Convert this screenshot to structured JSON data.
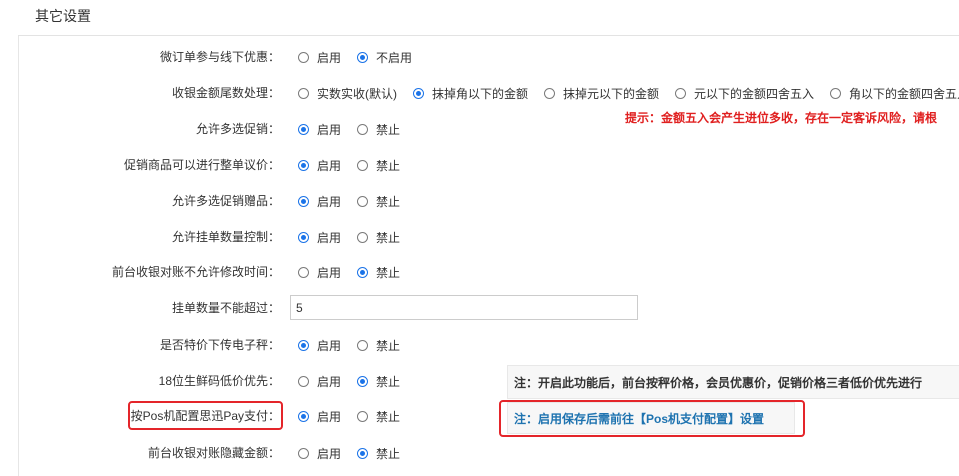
{
  "section": {
    "title": "其它设置"
  },
  "settings": [
    {
      "label": "微订单参与线下优惠：",
      "options": [
        {
          "label": "启用",
          "checked": false
        },
        {
          "label": "不启用",
          "checked": true
        }
      ]
    },
    {
      "label": "收银金额尾数处理：",
      "options": [
        {
          "label": "实数实收(默认)",
          "checked": false
        },
        {
          "label": "抹掉角以下的金额",
          "checked": true
        },
        {
          "label": "抹掉元以下的金额",
          "checked": false
        },
        {
          "label": "元以下的金额四舍五入",
          "checked": false
        },
        {
          "label": "角以下的金额四舍五入",
          "checked": false
        }
      ]
    },
    {
      "label": "允许多选促销：",
      "options": [
        {
          "label": "启用",
          "checked": true
        },
        {
          "label": "禁止",
          "checked": false
        }
      ]
    },
    {
      "label": "促销商品可以进行整单议价：",
      "options": [
        {
          "label": "启用",
          "checked": true
        },
        {
          "label": "禁止",
          "checked": false
        }
      ]
    },
    {
      "label": "允许多选促销赠品：",
      "options": [
        {
          "label": "启用",
          "checked": true
        },
        {
          "label": "禁止",
          "checked": false
        }
      ]
    },
    {
      "label": "允许挂单数量控制：",
      "options": [
        {
          "label": "启用",
          "checked": true
        },
        {
          "label": "禁止",
          "checked": false
        }
      ]
    },
    {
      "label": "前台收银对账不允许修改时间：",
      "options": [
        {
          "label": "启用",
          "checked": false
        },
        {
          "label": "禁止",
          "checked": true
        }
      ]
    },
    {
      "label": "挂单数量不能超过：",
      "input_value": "5"
    },
    {
      "label": "是否特价下传电子秤：",
      "options": [
        {
          "label": "启用",
          "checked": true
        },
        {
          "label": "禁止",
          "checked": false
        }
      ]
    },
    {
      "label": "18位生鲜码低价优先：",
      "options": [
        {
          "label": "启用",
          "checked": false
        },
        {
          "label": "禁止",
          "checked": true
        }
      ]
    },
    {
      "label": "按Pos机配置思迅Pay支付：",
      "options": [
        {
          "label": "启用",
          "checked": true
        },
        {
          "label": "禁止",
          "checked": false
        }
      ]
    },
    {
      "label": "前台收银对账隐藏金额：",
      "options": [
        {
          "label": "启用",
          "checked": false
        },
        {
          "label": "禁止",
          "checked": true
        }
      ]
    }
  ],
  "hints": {
    "rounding_warning": "提示：金额五入会产生进位多收，存在一定客诉风险，请根",
    "low_price_note": "注：开启此功能后，前台按秤价格，会员优惠价，促销价格三者低价优先进行",
    "pay_note": "注：启用保存后需前往【Pos机支付配置】设置"
  },
  "colors": {
    "accent": "#1a73e8",
    "warning": "#e02020",
    "link": "#1e73b0",
    "highlight_outline": "#e4252a"
  }
}
